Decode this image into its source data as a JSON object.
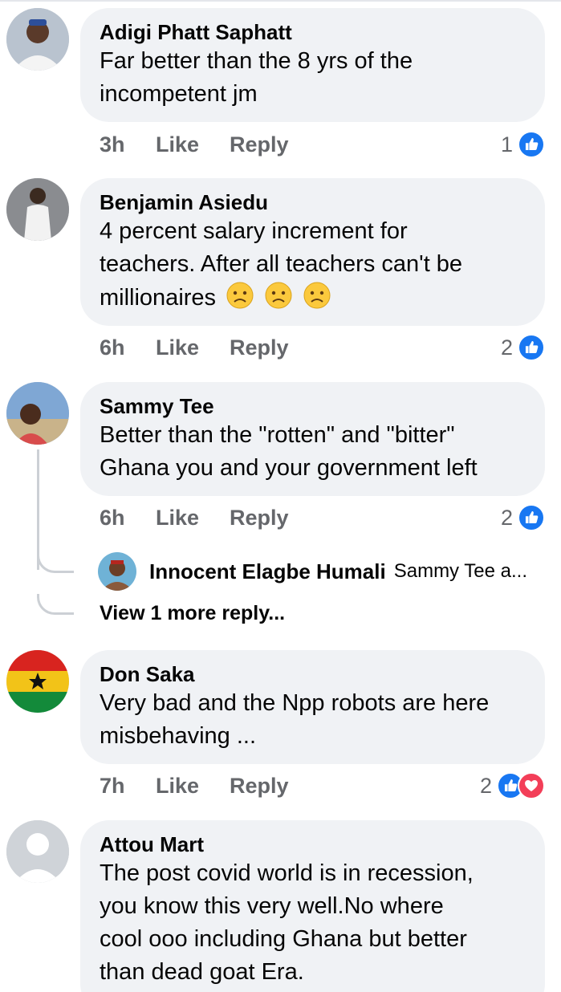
{
  "comments": [
    {
      "author": "Adigi Phatt Saphatt",
      "lines": [
        "Far better than the 8 yrs of the",
        "incompetent jm"
      ],
      "time": "3h",
      "like_label": "Like",
      "reply_label": "Reply",
      "reaction_count": "1",
      "reactions": [
        "like-icon"
      ]
    },
    {
      "author": "Benjamin Asiedu",
      "lines": [
        "4 percent salary increment for",
        "teachers. After all teachers can't be",
        "millionaires"
      ],
      "emoji": [
        "worried-face-icon",
        "worried-face-icon",
        "worried-face-icon"
      ],
      "time": "6h",
      "like_label": "Like",
      "reply_label": "Reply",
      "reaction_count": "2",
      "reactions": [
        "like-icon"
      ]
    },
    {
      "author": "Sammy Tee",
      "lines": [
        "Better than the \"rotten\" and \"bitter\"",
        "Ghana you and your government left"
      ],
      "time": "6h",
      "like_label": "Like",
      "reply_label": "Reply",
      "reaction_count": "2",
      "reactions": [
        "like-icon"
      ],
      "reply_preview": {
        "author": "Innocent Elagbe Humali",
        "snippet": "Sammy Tee a..."
      },
      "view_more": "View 1 more reply..."
    },
    {
      "author": "Don Saka",
      "lines": [
        "Very bad and the Npp robots are here",
        "misbehaving ..."
      ],
      "time": "7h",
      "like_label": "Like",
      "reply_label": "Reply",
      "reaction_count": "2",
      "reactions": [
        "like-icon",
        "love-icon"
      ]
    },
    {
      "author": "Attou Mart",
      "lines": [
        "The post covid world is in recession,",
        "you know this very well.No where",
        "cool ooo including Ghana but better",
        "than dead goat Era."
      ]
    }
  ],
  "colors": {
    "bubble": "#f0f2f5",
    "meta_text": "#65676b",
    "like_blue": "#1877f2",
    "love_red": "#f33e58"
  }
}
